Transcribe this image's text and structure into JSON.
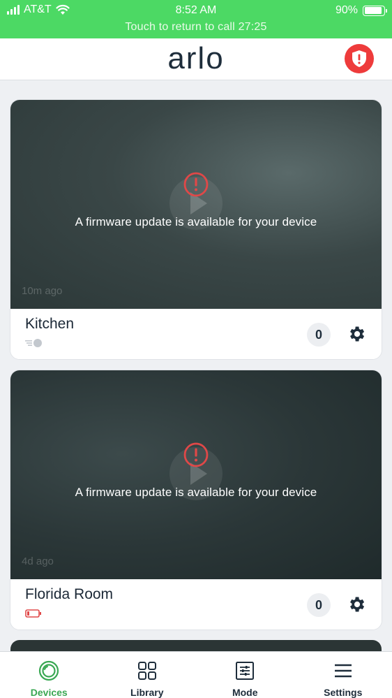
{
  "status_bar": {
    "carrier": "AT&T",
    "time": "8:52 AM",
    "battery": "90%",
    "battery_level": 0.9
  },
  "call_banner": "Touch to return to call 27:25",
  "header": {
    "logo": "arlo"
  },
  "cameras": [
    {
      "name": "Kitchen",
      "message": "A firmware update is available for your device",
      "ago": "10m ago",
      "count": "0",
      "status_icon": "signal-strength-icon"
    },
    {
      "name": "Florida Room",
      "message": "A firmware update is available for your device",
      "ago": "4d ago",
      "count": "0",
      "status_icon": "low-battery-icon"
    }
  ],
  "tabs": [
    {
      "label": "Devices",
      "icon": "devices-icon",
      "active": true
    },
    {
      "label": "Library",
      "icon": "library-grid-icon",
      "active": false
    },
    {
      "label": "Mode",
      "icon": "mode-sliders-icon",
      "active": false
    },
    {
      "label": "Settings",
      "icon": "menu-icon",
      "active": false
    }
  ],
  "colors": {
    "status_green": "#4cd964",
    "alert_red": "#ee3b3b",
    "active_tab": "#3aa853",
    "text_dark": "#1e2d3b"
  }
}
